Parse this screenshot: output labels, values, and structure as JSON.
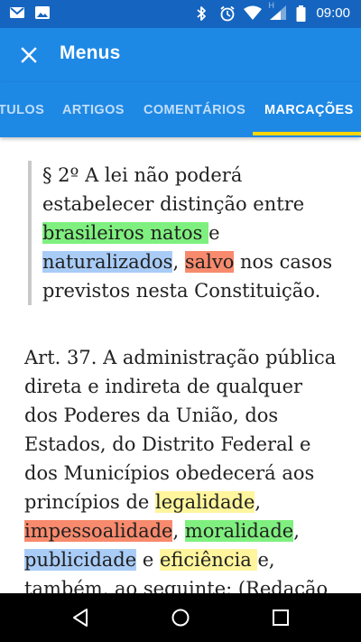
{
  "status_bar": {
    "time": "09:00",
    "icons": [
      "gmail-icon",
      "image-icon",
      "bluetooth-icon",
      "alarm-icon",
      "wifi-icon",
      "signal-h-icon",
      "signal-icon",
      "battery-icon"
    ],
    "h_label": "H"
  },
  "app_bar": {
    "title": "Menus",
    "close_icon": "close-icon",
    "background_color": "#1e88e5"
  },
  "tabs": [
    {
      "label": "TULOS",
      "active": false
    },
    {
      "label": "ARTIGOS",
      "active": false
    },
    {
      "label": "COMENTÁRIOS",
      "active": false
    },
    {
      "label": "MARCAÇÕES",
      "active": true
    }
  ],
  "indicator_color": "#ffd600",
  "quote": {
    "lines": [
      [
        {
          "text": "§ 2º A lei não poderá"
        }
      ],
      [
        {
          "text": "estabelecer distinção entre"
        }
      ],
      [
        {
          "text": "brasileiros natos ",
          "hl": "green"
        },
        {
          "text": "e"
        }
      ],
      [
        {
          "text": "naturalizados",
          "hl": "blue"
        },
        {
          "text": ", "
        },
        {
          "text": "salvo",
          "hl": "orange"
        },
        {
          "text": " nos casos"
        }
      ],
      [
        {
          "text": "previstos nesta Constituição."
        }
      ]
    ]
  },
  "article": {
    "lines": [
      [
        {
          "text": "Art. 37. A administração pública"
        }
      ],
      [
        {
          "text": "direta e indireta de qualquer"
        }
      ],
      [
        {
          "text": "dos Poderes da União, dos"
        }
      ],
      [
        {
          "text": "Estados, do Distrito Federal e"
        }
      ],
      [
        {
          "text": "dos Municípios obedecerá aos"
        }
      ],
      [
        {
          "text": "princípios de "
        },
        {
          "text": "legalidade",
          "hl": "yellow"
        },
        {
          "text": ","
        }
      ],
      [
        {
          "text": "impessoalidade",
          "hl": "orange"
        },
        {
          "text": ", "
        },
        {
          "text": "moralidade",
          "hl": "green"
        },
        {
          "text": ","
        }
      ],
      [
        {
          "text": "publicidade",
          "hl": "blue"
        },
        {
          "text": " e "
        },
        {
          "text": "eficiência ",
          "hl": "yellow"
        },
        {
          "text": "e,"
        }
      ],
      [
        {
          "text": "também, ao seguinte:   (Redação"
        }
      ]
    ]
  },
  "highlight_colors": {
    "green": "#7ff07f",
    "blue": "#a9ccf7",
    "orange": "#f88a6d",
    "yellow": "#fff59d"
  },
  "nav_bar": {
    "buttons": [
      "back-icon",
      "home-icon",
      "recents-icon"
    ]
  }
}
